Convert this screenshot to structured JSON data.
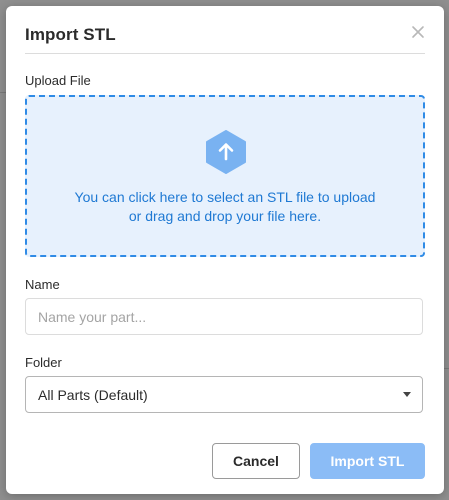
{
  "dialog": {
    "title": "Import STL",
    "close_icon": "close-icon"
  },
  "upload": {
    "label": "Upload File",
    "icon": "upload-arrow-icon",
    "line1": "You can click here to select an STL file to upload",
    "line2": "or drag and drop your file here."
  },
  "name_field": {
    "label": "Name",
    "value": "",
    "placeholder": "Name your part..."
  },
  "folder_field": {
    "label": "Folder",
    "selected": "All Parts (Default)"
  },
  "buttons": {
    "cancel": "Cancel",
    "import": "Import STL"
  },
  "colors": {
    "accent": "#2f8be6",
    "dropzone_bg": "#e7f1fd",
    "primary_disabled": "#8bbcf6"
  }
}
